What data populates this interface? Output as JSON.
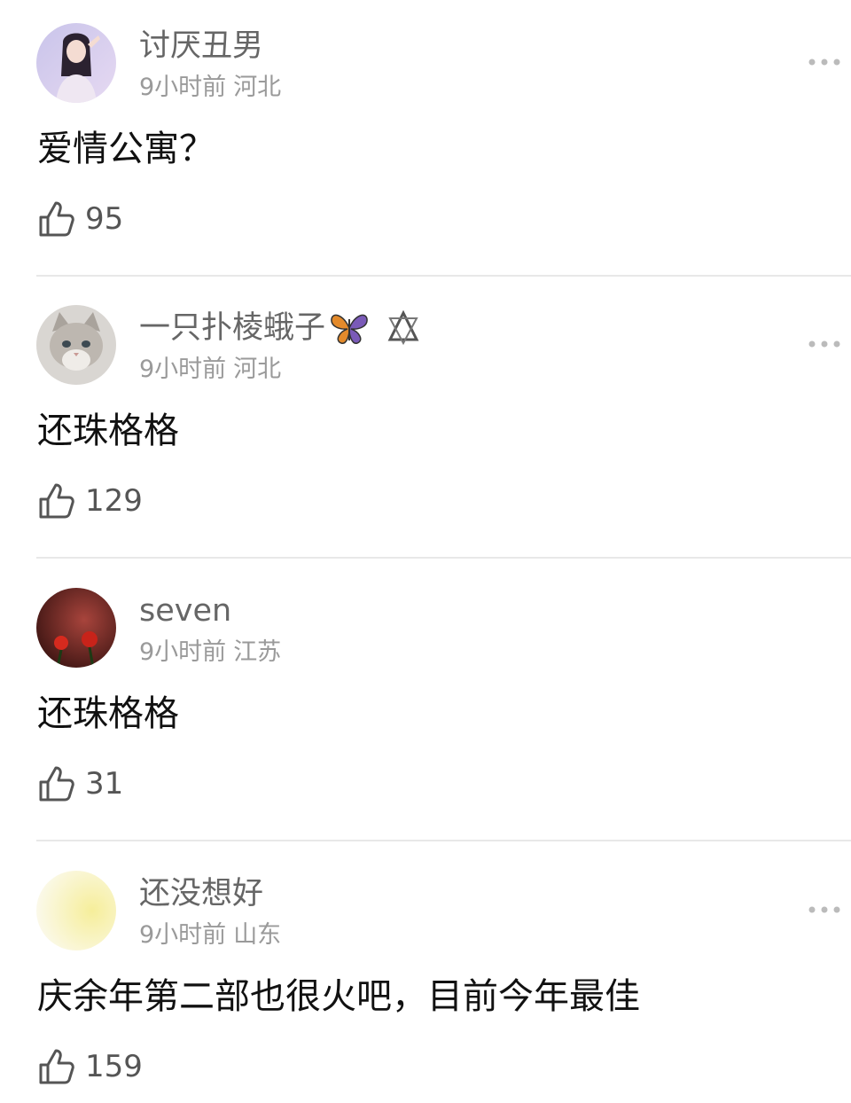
{
  "comments": [
    {
      "username": "讨厌丑男",
      "time": "9小时前",
      "location": "河北",
      "text": "爱情公寓？",
      "likes": "95",
      "avatar_icon": "girl-portrait-avatar"
    },
    {
      "username": "一只扑棱蛾子",
      "time": "9小时前",
      "location": "河北",
      "text": "还珠格格",
      "likes": "129",
      "avatar_icon": "gray-cat-avatar",
      "badges": [
        "butterfly-icon",
        "star-badge-icon"
      ]
    },
    {
      "username": "seven",
      "time": "9小时前",
      "location": "江苏",
      "text": "还珠格格",
      "likes": "31",
      "avatar_icon": "red-roses-avatar"
    },
    {
      "username": "还没想好",
      "time": "9小时前",
      "location": "山东",
      "text": "庆余年第二部也很火吧，目前今年最佳",
      "likes": "159",
      "avatar_icon": "pale-yellow-light-avatar"
    }
  ],
  "colors": {
    "username": "#666666",
    "meta": "#9a9a9a",
    "text": "#111111",
    "divider": "#e8e8e8"
  }
}
